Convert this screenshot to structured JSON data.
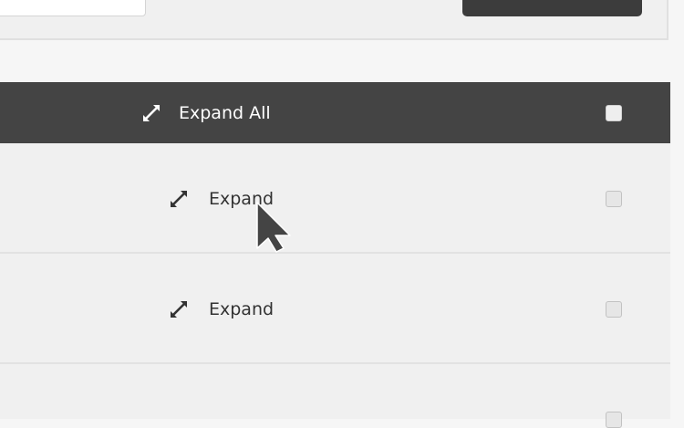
{
  "table": {
    "header": {
      "expand_all_label": "Expand All",
      "icon": "expand-icon"
    },
    "rows": [
      {
        "expand_label": "Expand",
        "icon": "expand-icon"
      },
      {
        "expand_label": "Expand",
        "icon": "expand-icon"
      }
    ]
  },
  "colors": {
    "header_bg": "#444444",
    "row_bg": "#f0f0f0",
    "page_bg": "#f6f6f6",
    "text_dark": "#333333",
    "text_light": "#ffffff"
  }
}
